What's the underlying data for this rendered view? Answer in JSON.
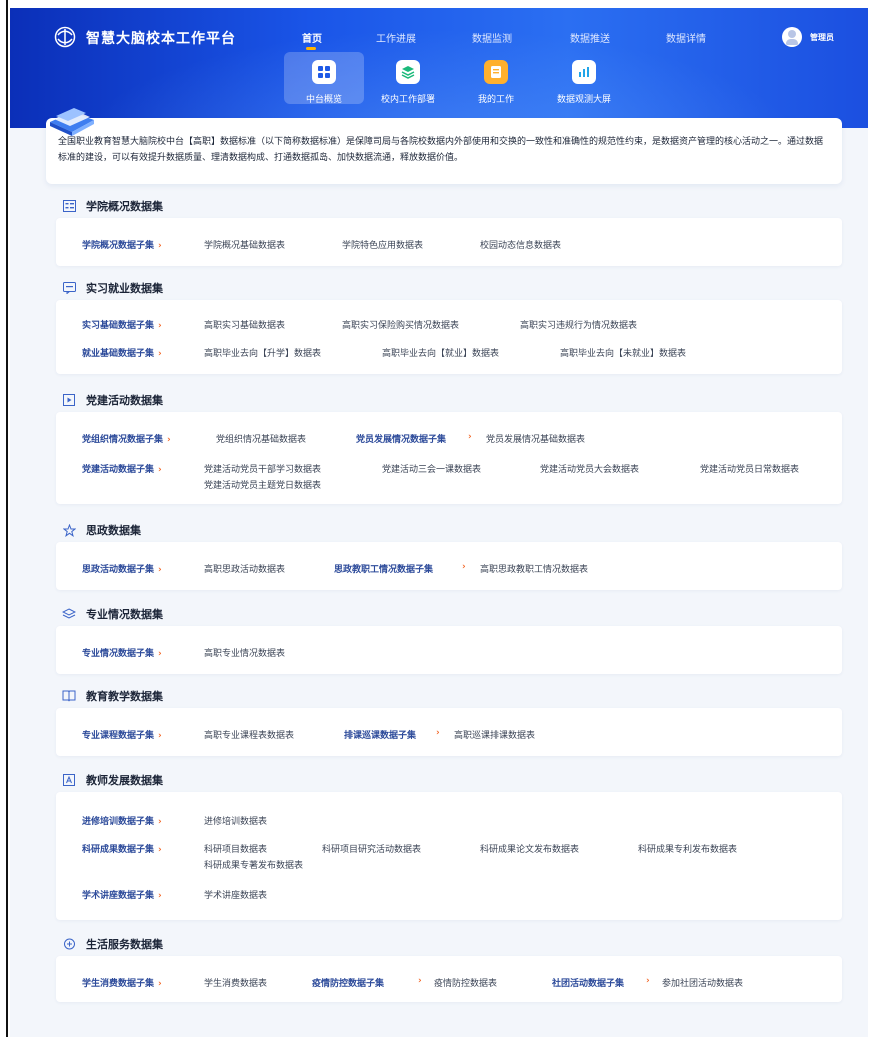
{
  "app": {
    "title": "智慧大脑校本工作平台",
    "user": "管理员"
  },
  "nav": [
    "首页",
    "工作进展",
    "数据监测",
    "数据推送",
    "数据详情"
  ],
  "subnav": [
    "中台概览",
    "校内工作部署",
    "我的工作",
    "数据观测大屏"
  ],
  "intro": "全国职业教育智慧大脑院校中台【高职】数据标准（以下简称数据标准）是保障司局与各院校数据内外部使用和交换的一致性和准确性的规范性约束，是数据资产管理的核心活动之一。通过数据标准的建设，可以有效提升数据质量、理清数据构成、打通数据孤岛、加快数据流通，释放数据价值。",
  "sections": [
    {
      "title": "学院概况数据集",
      "icon": "list-icon",
      "rows": [
        {
          "category": "学院概况数据子集",
          "items": [
            "学院概况基础数据表",
            "学院特色应用数据表",
            "校园动态信息数据表"
          ]
        }
      ]
    },
    {
      "title": "实习就业数据集",
      "icon": "chat-icon",
      "rows": [
        {
          "category": "实习基础数据子集",
          "items": [
            "高职实习基础数据表",
            "高职实习保险购买情况数据表",
            "高职实习违规行为情况数据表"
          ]
        },
        {
          "category": "就业基础数据子集",
          "items": [
            "高职毕业去向【升学】数据表",
            "高职毕业去向【就业】数据表",
            "高职毕业去向【未就业】数据表"
          ]
        }
      ]
    },
    {
      "title": "党建活动数据集",
      "icon": "play-icon",
      "rows": [
        {
          "category": "党组织情况数据子集",
          "items": [
            "党组织情况基础数据表"
          ]
        },
        {
          "category": "党员发展情况数据子集",
          "items": [
            "党员发展情况基础数据表"
          ]
        },
        {
          "category": "党建活动数据子集",
          "items": [
            "党建活动党员干部学习数据表",
            "党建活动三会一课数据表",
            "党建活动党员大会数据表",
            "党建活动党员日常数据表",
            "党建活动党员主题党日数据表"
          ]
        }
      ]
    },
    {
      "title": "思政数据集",
      "icon": "star-icon",
      "rows": [
        {
          "category": "思政活动数据子集",
          "items": [
            "高职思政活动数据表"
          ]
        },
        {
          "category": "思政教职工情况数据子集",
          "items": [
            "高职思政教职工情况数据表"
          ]
        }
      ]
    },
    {
      "title": "专业情况数据集",
      "icon": "layers-icon",
      "rows": [
        {
          "category": "专业情况数据子集",
          "items": [
            "高职专业情况数据表"
          ]
        }
      ]
    },
    {
      "title": "教育教学数据集",
      "icon": "book-icon",
      "rows": [
        {
          "category": "专业课程数据子集",
          "items": [
            "高职专业课程表数据表"
          ]
        },
        {
          "category": "排课巡课数据子集",
          "items": [
            "高职巡课排课数据表"
          ]
        }
      ]
    },
    {
      "title": "教师发展数据集",
      "icon": "teacher-icon",
      "rows": [
        {
          "category": "进修培训数据子集",
          "items": [
            "进修培训数据表"
          ]
        },
        {
          "category": "科研成果数据子集",
          "items": [
            "科研项目数据表",
            "科研项目研究活动数据表",
            "科研成果论文发布数据表",
            "科研成果专利发布数据表",
            "科研成果专著发布数据表"
          ]
        },
        {
          "category": "学术讲座数据子集",
          "items": [
            "学术讲座数据表"
          ]
        }
      ]
    },
    {
      "title": "生活服务数据集",
      "icon": "life-icon",
      "rows": [
        {
          "category": "学生消费数据子集",
          "items": [
            "学生消费数据表"
          ]
        },
        {
          "category": "疫情防控数据子集",
          "items": [
            "疫情防控数据表"
          ]
        },
        {
          "category": "社团活动数据子集",
          "items": [
            "参加社团活动数据表"
          ]
        }
      ]
    }
  ]
}
